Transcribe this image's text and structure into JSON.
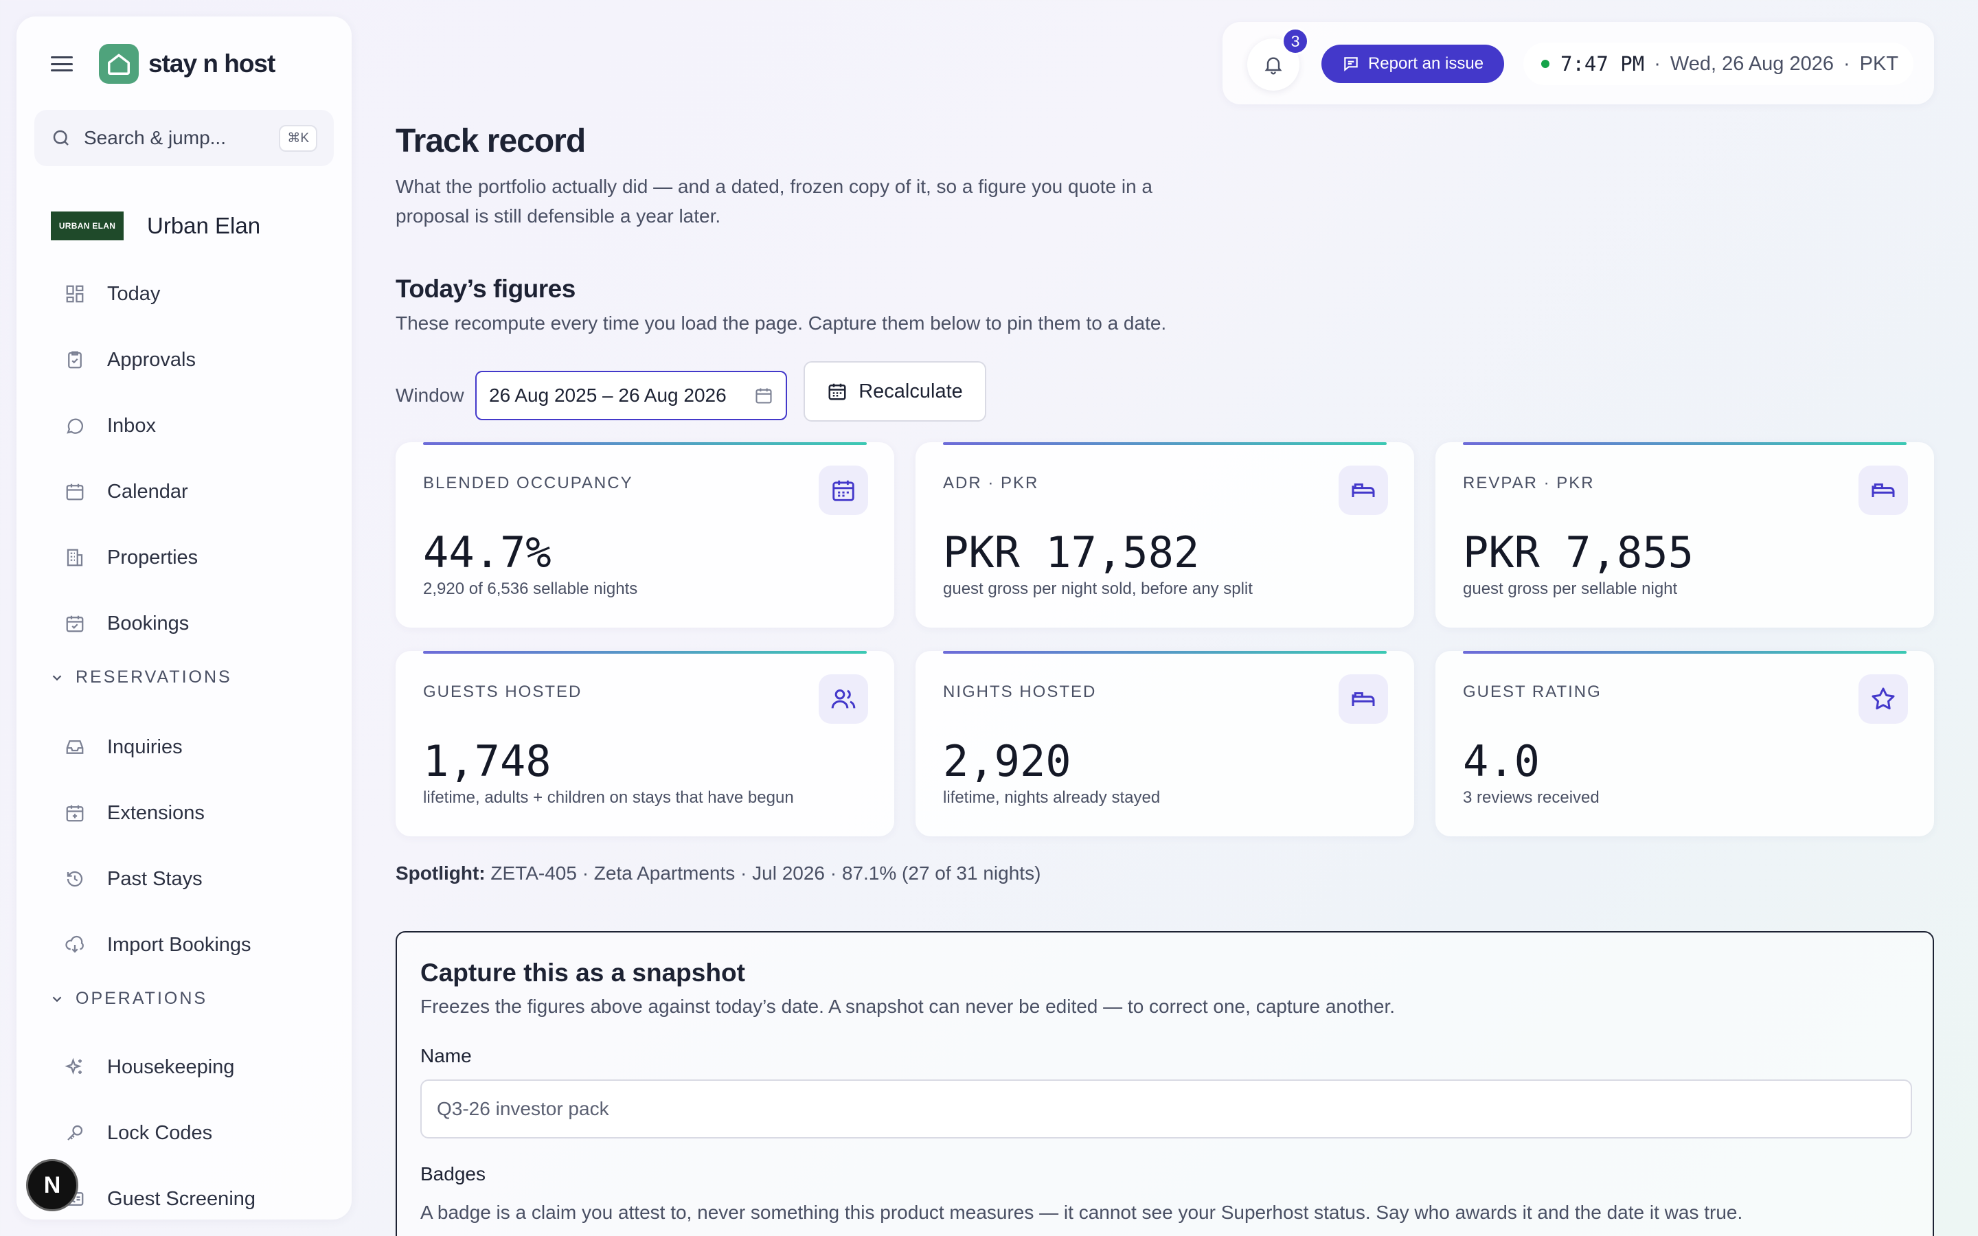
{
  "sidebar": {
    "brand": "stay n host",
    "search_placeholder": "Search & jump...",
    "search_shortcut": "⌘K",
    "org_logo_text": "URBAN ELAN",
    "org_name": "Urban Elan",
    "items": [
      {
        "label": "Today",
        "icon": "dashboard-icon"
      },
      {
        "label": "Approvals",
        "icon": "clipboard-check-icon"
      },
      {
        "label": "Inbox",
        "icon": "chat-bubble-icon"
      },
      {
        "label": "Calendar",
        "icon": "calendar-icon"
      },
      {
        "label": "Properties",
        "icon": "building-icon"
      },
      {
        "label": "Bookings",
        "icon": "calendar-check-icon"
      }
    ],
    "reservations_heading": "RESERVATIONS",
    "reservations": [
      {
        "label": "Inquiries",
        "icon": "inbox-tray-icon"
      },
      {
        "label": "Extensions",
        "icon": "calendar-plus-icon"
      },
      {
        "label": "Past Stays",
        "icon": "history-icon"
      },
      {
        "label": "Import Bookings",
        "icon": "cloud-import-icon"
      }
    ],
    "operations_heading": "OPERATIONS",
    "operations": [
      {
        "label": "Housekeeping",
        "icon": "sparkles-icon"
      },
      {
        "label": "Lock Codes",
        "icon": "key-icon"
      },
      {
        "label": "Guest Screening",
        "icon": "id-card-icon"
      }
    ],
    "avatar_initial": "N"
  },
  "topbar": {
    "notification_count": "3",
    "report_label": "Report an issue",
    "time": "7:47 PM",
    "date": "Wed, 26 Aug 2026",
    "timezone": "PKT"
  },
  "page": {
    "title": "Track record",
    "lead": "What the portfolio actually did — and a dated, frozen copy of it, so a figure you quote in a proposal is still defensible a year later.",
    "section_title": "Today’s figures",
    "section_sub": "These recompute every time you load the page. Capture them below to pin them to a date.",
    "window_label": "Window",
    "window_value": "26 Aug 2025 – 26 Aug 2026",
    "recalc_label": "Recalculate"
  },
  "metrics": [
    {
      "label": "BLENDED OCCUPANCY",
      "value": "44.7%",
      "note": "2,920 of 6,536 sellable nights",
      "icon": "calendar-grid-icon"
    },
    {
      "label": "ADR · PKR",
      "value": "PKR 17,582",
      "note": "guest gross per night sold, before any split",
      "icon": "bed-icon"
    },
    {
      "label": "REVPAR · PKR",
      "value": "PKR 7,855",
      "note": "guest gross per sellable night",
      "icon": "bed-icon"
    },
    {
      "label": "GUESTS HOSTED",
      "value": "1,748",
      "note": "lifetime, adults + children on stays that have begun",
      "icon": "users-icon"
    },
    {
      "label": "NIGHTS HOSTED",
      "value": "2,920",
      "note": "lifetime, nights already stayed",
      "icon": "bed-icon"
    },
    {
      "label": "GUEST RATING",
      "value": "4.0",
      "note": "3 reviews received",
      "icon": "star-icon"
    }
  ],
  "spotlight": {
    "label": "Spotlight:",
    "text": "ZETA-405 · Zeta Apartments · Jul 2026 · 87.1% (27 of 31 nights)"
  },
  "snapshot": {
    "title": "Capture this as a snapshot",
    "desc": "Freezes the figures above against today’s date. A snapshot can never be edited — to correct one, capture another.",
    "name_label": "Name",
    "name_placeholder": "Q3-26 investor pack",
    "badges_label": "Badges",
    "badges_desc": "A badge is a claim you attest to, never something this product measures — it cannot see your Superhost status. Say who awards it and the date it was true."
  },
  "colors": {
    "accent": "#4338ca",
    "brand_green": "#4fa37c",
    "online": "#16a34a"
  }
}
